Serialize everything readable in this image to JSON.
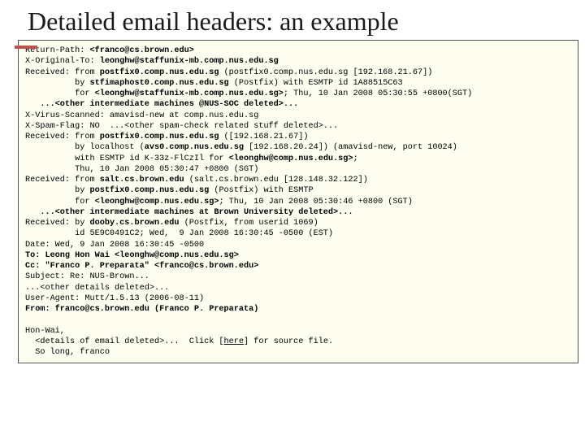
{
  "title": "Detailed email headers: an example",
  "h": {
    "l01a": "Return-Path: ",
    "l01b": "<franco@cs.brown.edu>",
    "l02a": "X-Original-To: ",
    "l02b": "leonghw@staffunix-mb.comp.nus.edu.sg",
    "l03a": "Received: from ",
    "l03b": "postfix0.comp.nus.edu.sg",
    "l03c": " (postfix0.comp.nus.edu.sg [192.168.21.67])",
    "l04a": "          by ",
    "l04b": "stfimaphost0.comp.nus.edu.sg",
    "l04c": " (Postfix) with ESMTP id 1A88515C63",
    "l05a": "          for ",
    "l05b": "<leonghw@staffunix-mb.comp.nus.edu.sg>",
    "l05c": "; Thu, 10 Jan 2008 05:30:55 +0800(SGT)",
    "l06": "   ...<other intermediate machines @NUS-SOC deleted>...",
    "l07": "X-Virus-Scanned: amavisd-new at comp.nus.edu.sg",
    "l08": "X-Spam-Flag: NO  ...<other spam-check related stuff deleted>...",
    "l09a": "Received: from ",
    "l09b": "postfix0.comp.nus.edu.sg",
    "l09c": " ([192.168.21.67])",
    "l10a": "          by localhost (",
    "l10b": "avs0.comp.nus.edu.sg",
    "l10c": " [192.168.20.24]) (amavisd-new, port 10024)",
    "l11a": "          with ESMTP id K-33z-FlCzIl for ",
    "l11b": "<leonghw@comp.nus.edu.sg>",
    "l11c": ";",
    "l12": "          Thu, 10 Jan 2008 05:30:47 +0800 (SGT)",
    "l13a": "Received: from ",
    "l13b": "salt.cs.brown.edu",
    "l13c": " (salt.cs.brown.edu [128.148.32.122])",
    "l14a": "          by ",
    "l14b": "postfix0.comp.nus.edu.sg",
    "l14c": " (Postfix) with ESMTP",
    "l15a": "          for ",
    "l15b": "<leonghw@comp.nus.edu.sg>",
    "l15c": "; Thu, 10 Jan 2008 05:30:46 +0800 (SGT)",
    "l16": "   ...<other intermediate machines at Brown University deleted>...",
    "l17a": "Received: by ",
    "l17b": "dooby.cs.brown.edu",
    "l17c": " (Postfix, from userid 1069)",
    "l18": "          id 5E9C0491C2; Wed,  9 Jan 2008 16:30:45 -0500 (EST)",
    "l19": "Date: Wed, 9 Jan 2008 16:30:45 -0500",
    "l20": "To: Leong Hon Wai <leonghw@comp.nus.edu.sg>",
    "l21": "Cc: \"Franco P. Preparata\" <franco@cs.brown.edu>",
    "l22": "Subject: Re: NUS-Brown...",
    "l23": "...<other details deleted>...",
    "l24": "User-Agent: Mutt/1.5.13 (2006-08-11)",
    "l25": "From: franco@cs.brown.edu (Franco P. Preparata)",
    "l26": "Hon-Wai,",
    "l27a": "  <details of email deleted>...  Click [",
    "l27b": "here",
    "l27c": "] for source file.",
    "l28": "  So long, franco"
  }
}
